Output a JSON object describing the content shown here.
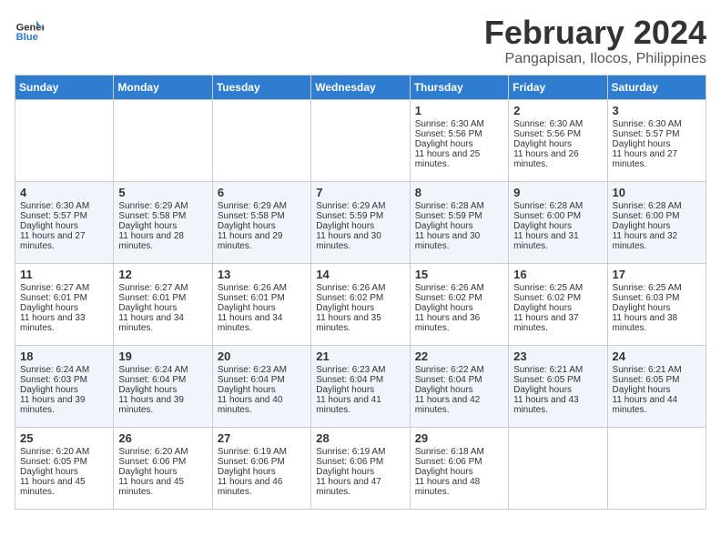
{
  "header": {
    "logo_line1": "General",
    "logo_line2": "Blue",
    "month": "February 2024",
    "location": "Pangapisan, Ilocos, Philippines"
  },
  "days_of_week": [
    "Sunday",
    "Monday",
    "Tuesday",
    "Wednesday",
    "Thursday",
    "Friday",
    "Saturday"
  ],
  "weeks": [
    [
      {
        "day": "",
        "empty": true
      },
      {
        "day": "",
        "empty": true
      },
      {
        "day": "",
        "empty": true
      },
      {
        "day": "",
        "empty": true
      },
      {
        "day": "1",
        "sunrise": "6:30 AM",
        "sunset": "5:56 PM",
        "daylight": "11 hours and 25 minutes."
      },
      {
        "day": "2",
        "sunrise": "6:30 AM",
        "sunset": "5:56 PM",
        "daylight": "11 hours and 26 minutes."
      },
      {
        "day": "3",
        "sunrise": "6:30 AM",
        "sunset": "5:57 PM",
        "daylight": "11 hours and 27 minutes."
      }
    ],
    [
      {
        "day": "4",
        "sunrise": "6:30 AM",
        "sunset": "5:57 PM",
        "daylight": "11 hours and 27 minutes."
      },
      {
        "day": "5",
        "sunrise": "6:29 AM",
        "sunset": "5:58 PM",
        "daylight": "11 hours and 28 minutes."
      },
      {
        "day": "6",
        "sunrise": "6:29 AM",
        "sunset": "5:58 PM",
        "daylight": "11 hours and 29 minutes."
      },
      {
        "day": "7",
        "sunrise": "6:29 AM",
        "sunset": "5:59 PM",
        "daylight": "11 hours and 30 minutes."
      },
      {
        "day": "8",
        "sunrise": "6:28 AM",
        "sunset": "5:59 PM",
        "daylight": "11 hours and 30 minutes."
      },
      {
        "day": "9",
        "sunrise": "6:28 AM",
        "sunset": "6:00 PM",
        "daylight": "11 hours and 31 minutes."
      },
      {
        "day": "10",
        "sunrise": "6:28 AM",
        "sunset": "6:00 PM",
        "daylight": "11 hours and 32 minutes."
      }
    ],
    [
      {
        "day": "11",
        "sunrise": "6:27 AM",
        "sunset": "6:01 PM",
        "daylight": "11 hours and 33 minutes."
      },
      {
        "day": "12",
        "sunrise": "6:27 AM",
        "sunset": "6:01 PM",
        "daylight": "11 hours and 34 minutes."
      },
      {
        "day": "13",
        "sunrise": "6:26 AM",
        "sunset": "6:01 PM",
        "daylight": "11 hours and 34 minutes."
      },
      {
        "day": "14",
        "sunrise": "6:26 AM",
        "sunset": "6:02 PM",
        "daylight": "11 hours and 35 minutes."
      },
      {
        "day": "15",
        "sunrise": "6:26 AM",
        "sunset": "6:02 PM",
        "daylight": "11 hours and 36 minutes."
      },
      {
        "day": "16",
        "sunrise": "6:25 AM",
        "sunset": "6:02 PM",
        "daylight": "11 hours and 37 minutes."
      },
      {
        "day": "17",
        "sunrise": "6:25 AM",
        "sunset": "6:03 PM",
        "daylight": "11 hours and 38 minutes."
      }
    ],
    [
      {
        "day": "18",
        "sunrise": "6:24 AM",
        "sunset": "6:03 PM",
        "daylight": "11 hours and 39 minutes."
      },
      {
        "day": "19",
        "sunrise": "6:24 AM",
        "sunset": "6:04 PM",
        "daylight": "11 hours and 39 minutes."
      },
      {
        "day": "20",
        "sunrise": "6:23 AM",
        "sunset": "6:04 PM",
        "daylight": "11 hours and 40 minutes."
      },
      {
        "day": "21",
        "sunrise": "6:23 AM",
        "sunset": "6:04 PM",
        "daylight": "11 hours and 41 minutes."
      },
      {
        "day": "22",
        "sunrise": "6:22 AM",
        "sunset": "6:04 PM",
        "daylight": "11 hours and 42 minutes."
      },
      {
        "day": "23",
        "sunrise": "6:21 AM",
        "sunset": "6:05 PM",
        "daylight": "11 hours and 43 minutes."
      },
      {
        "day": "24",
        "sunrise": "6:21 AM",
        "sunset": "6:05 PM",
        "daylight": "11 hours and 44 minutes."
      }
    ],
    [
      {
        "day": "25",
        "sunrise": "6:20 AM",
        "sunset": "6:05 PM",
        "daylight": "11 hours and 45 minutes."
      },
      {
        "day": "26",
        "sunrise": "6:20 AM",
        "sunset": "6:06 PM",
        "daylight": "11 hours and 45 minutes."
      },
      {
        "day": "27",
        "sunrise": "6:19 AM",
        "sunset": "6:06 PM",
        "daylight": "11 hours and 46 minutes."
      },
      {
        "day": "28",
        "sunrise": "6:19 AM",
        "sunset": "6:06 PM",
        "daylight": "11 hours and 47 minutes."
      },
      {
        "day": "29",
        "sunrise": "6:18 AM",
        "sunset": "6:06 PM",
        "daylight": "11 hours and 48 minutes."
      },
      {
        "day": "",
        "empty": true
      },
      {
        "day": "",
        "empty": true
      }
    ]
  ]
}
